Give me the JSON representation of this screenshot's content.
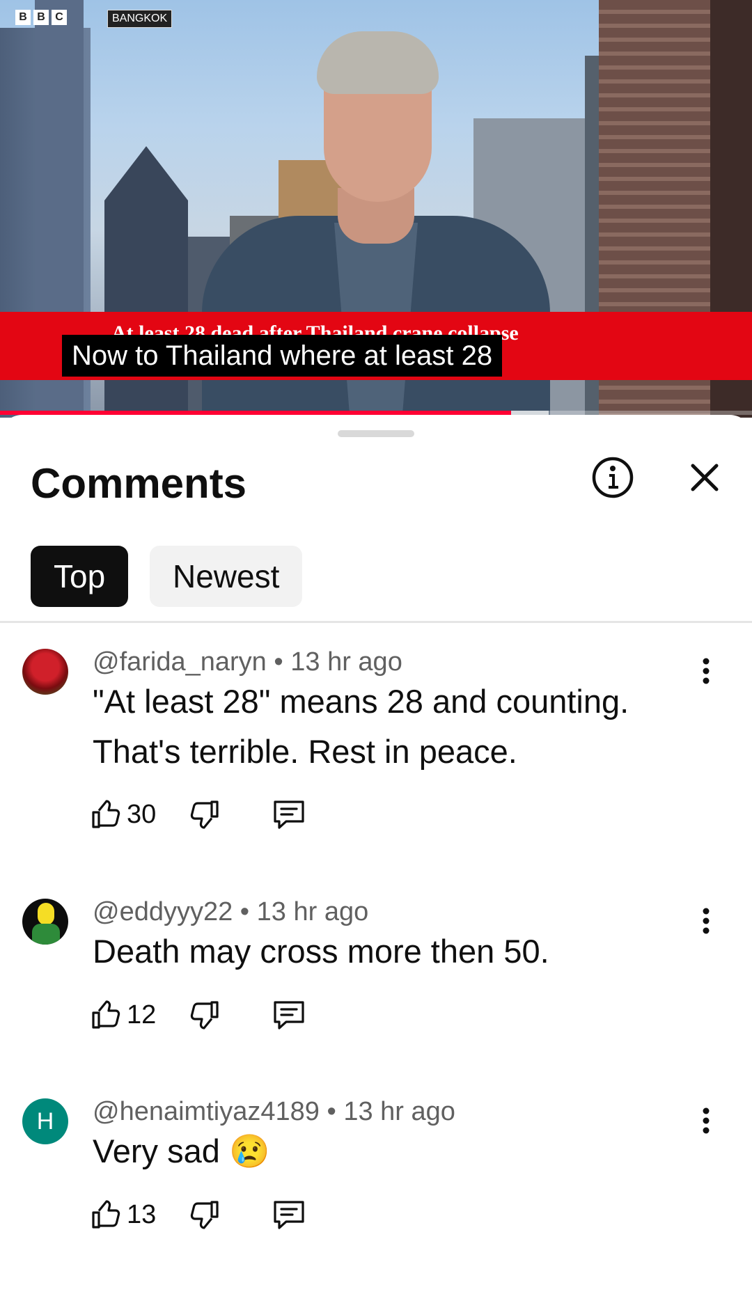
{
  "video": {
    "channel_logo": [
      "B",
      "B",
      "C"
    ],
    "location": "BANGKOK",
    "ticker": "At least 28 dead after Thailand crane collapse",
    "caption": "Now to Thailand where at least 28",
    "progress": 0.68,
    "buffered": 0.73,
    "progress_color": "#ff0033",
    "banner_color": "#e30613"
  },
  "panel": {
    "title": "Comments",
    "info_icon": "info-icon",
    "close_icon": "close-icon",
    "tabs": [
      {
        "label": "Top",
        "selected": true
      },
      {
        "label": "Newest",
        "selected": false
      }
    ]
  },
  "comments": [
    {
      "author": "@farida_naryn",
      "time": "13 hr ago",
      "lines": [
        "\"At least 28\" means 28 and counting.",
        "That's terrible. Rest in peace."
      ],
      "likes": "30",
      "avatar": "roses"
    },
    {
      "author": "@eddyyy22",
      "time": "13 hr ago",
      "lines": [
        "Death may cross more then 50."
      ],
      "likes": "12",
      "avatar": "cartoon"
    },
    {
      "author": "@henaimtiyaz4189",
      "time": "13 hr ago",
      "lines": [
        "Very sad 😢"
      ],
      "likes": "13",
      "avatar": "H",
      "avatar_color": "#00897b"
    }
  ],
  "separator": " • "
}
